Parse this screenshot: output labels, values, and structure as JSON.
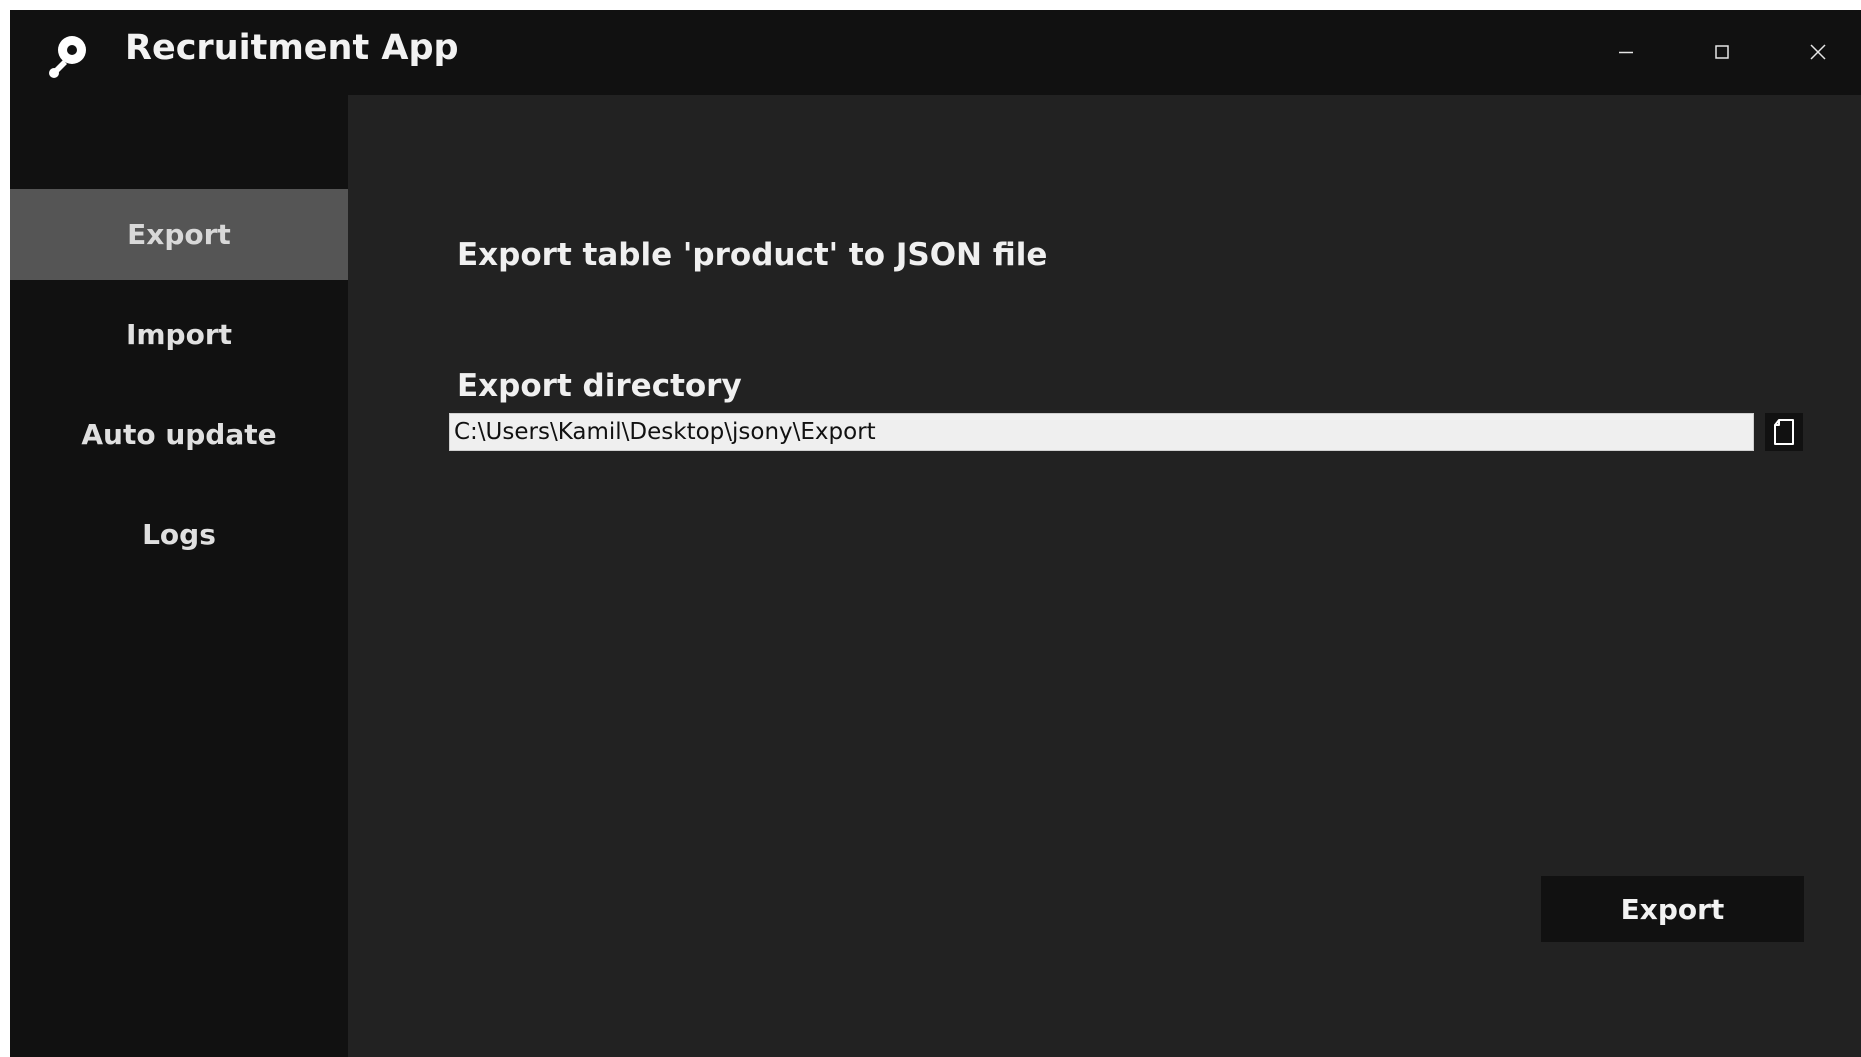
{
  "window": {
    "title": "Recruitment App",
    "controls": {
      "minimize_icon": "minimize-icon",
      "maximize_icon": "maximize-icon",
      "close_icon": "close-icon"
    }
  },
  "sidebar": {
    "items": [
      {
        "label": "Export",
        "active": true
      },
      {
        "label": "Import",
        "active": false
      },
      {
        "label": "Auto update",
        "active": false
      },
      {
        "label": "Logs",
        "active": false
      }
    ]
  },
  "main": {
    "heading": "Export table 'product' to JSON file",
    "directory_label": "Export directory",
    "directory_value": "C:\\Users\\Kamil\\Desktop\\jsony\\Export",
    "browse_icon": "folder-browse-icon",
    "export_button": "Export"
  },
  "colors": {
    "window_bg": "#111111",
    "content_bg": "#222222",
    "active_nav_bg": "#555555",
    "input_bg": "#efefef"
  }
}
